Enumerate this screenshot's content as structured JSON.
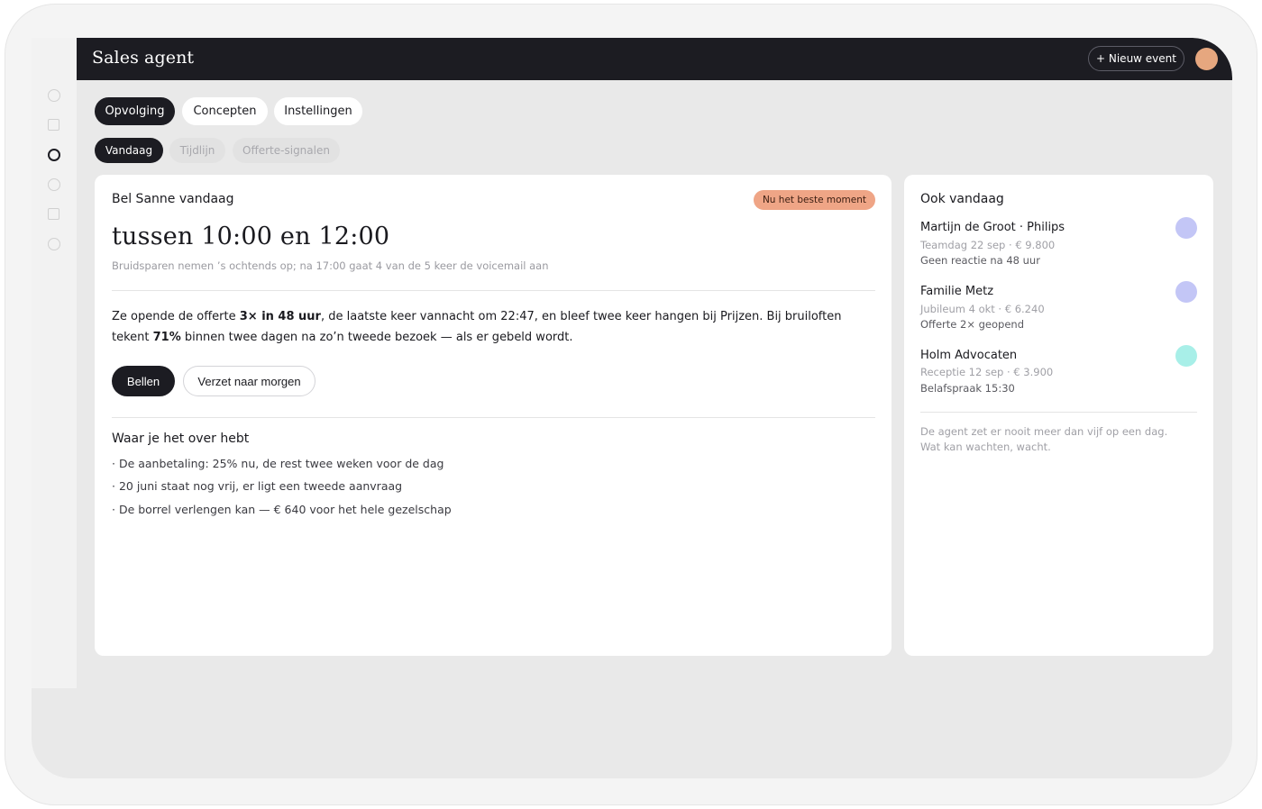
{
  "app": {
    "title": "Sales agent",
    "new_event_label": "+ Nieuw event"
  },
  "tabs": [
    {
      "label": "Opvolging",
      "active": true
    },
    {
      "label": "Concepten",
      "active": false
    },
    {
      "label": "Instellingen",
      "active": false
    }
  ],
  "subtabs": [
    {
      "label": "Vandaag",
      "active": true
    },
    {
      "label": "Tijdlijn",
      "active": false
    },
    {
      "label": "Offerte-signalen",
      "active": false
    }
  ],
  "main": {
    "heading": "Bel Sanne vandaag",
    "badge": "Nu het beste moment",
    "time": "tussen 10:00 en 12:00",
    "subtitle": "Bruidsparen nemen ’s ochtends op; na 17:00 gaat 4 van de 5 keer de voicemail aan",
    "insight": {
      "p1": "Ze opende de offerte ",
      "b1": "3× in 48 uur",
      "p2": ", de laatste keer vannacht om 22:47, en bleef twee keer hangen bij Prijzen. Bij bruiloften tekent ",
      "b2": "71%",
      "p3": " binnen twee dagen na zo’n tweede bezoek — als er gebeld wordt."
    },
    "call_label": "Bellen",
    "postpone_label": "Verzet naar morgen",
    "topics_title": "Waar je het over hebt",
    "topics": [
      "· De aanbetaling: 25% nu, de rest twee weken voor de dag",
      "· 20 juni staat nog vrij, er ligt een tweede aanvraag",
      "· De borrel verlengen kan — € 640 voor het hele gezelschap"
    ]
  },
  "side": {
    "title": "Ook vandaag",
    "people": [
      {
        "name": "Martijn de Groot · Philips",
        "meta": "Teamdag 22 sep · € 9.800",
        "note": "Geen reactie na 48 uur",
        "color": "#c3c6f6"
      },
      {
        "name": "Familie Metz",
        "meta": "Jubileum 4 okt · € 6.240",
        "note": "Offerte 2× geopend",
        "color": "#c3c6f6"
      },
      {
        "name": "Holm Advocaten",
        "meta": "Receptie 12 sep · € 3.900",
        "note": "Belafspraak 15:30",
        "color": "#a8efe8"
      }
    ],
    "footer": "De agent zet er nooit meer dan vijf op een dag. Wat kan wachten, wacht."
  },
  "icons": {
    "logo": "sparkle-icon",
    "nav": [
      "circle-icon",
      "square-icon",
      "circle-icon",
      "circle-icon",
      "square-icon",
      "circle-icon"
    ]
  },
  "colors": {
    "topbar": "#1c1c22",
    "badge": "#efa586",
    "avatar": "#e6a77f"
  }
}
